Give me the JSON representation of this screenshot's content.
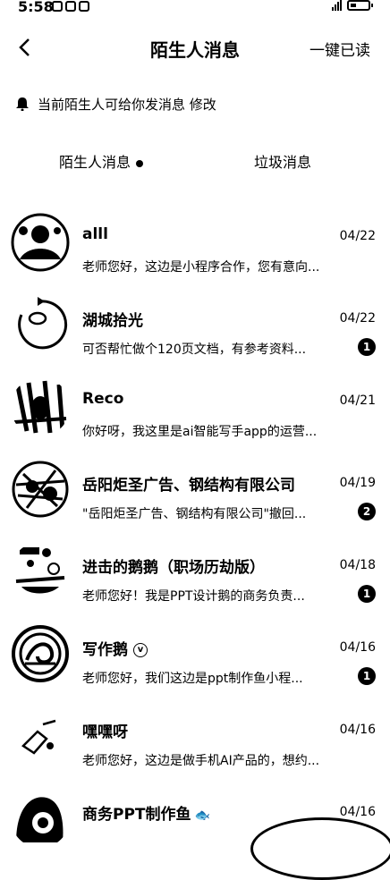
{
  "status": {
    "time": "5:58"
  },
  "header": {
    "title": "陌生人消息",
    "action": "一键已读"
  },
  "notice": {
    "text": "当前陌生人可给你发消息 修改"
  },
  "tabs": [
    {
      "label": "陌生人消息"
    },
    {
      "label": "垃圾消息"
    }
  ],
  "items": [
    {
      "name": "alll",
      "date": "04/22",
      "msg": "老师您好，这边是小程序合作，您有意向...",
      "badge": ""
    },
    {
      "name": "湖城拾光",
      "date": "04/22",
      "msg": "可否帮忙做个120页文档，有参考资料...",
      "badge": "1"
    },
    {
      "name": "Reco",
      "date": "04/21",
      "msg": "你好呀，我这里是ai智能写手app的运营...",
      "badge": ""
    },
    {
      "name": "岳阳炬圣广告、钢结构有限公司",
      "date": "04/19",
      "msg": "\"岳阳炬圣广告、钢结构有限公司\"撤回...",
      "badge": "2"
    },
    {
      "name": "进击的鹅鹅（职场历劫版）",
      "date": "04/18",
      "msg": "老师您好！我是PPT设计鹅的商务负责...",
      "badge": "1"
    },
    {
      "name": "写作鹅",
      "date": "04/16",
      "msg": "老师您好，我们这边是ppt制作鱼小程...",
      "badge": "1"
    },
    {
      "name": "嘿嘿呀",
      "date": "04/16",
      "msg": "老师您好，这边是做手机AI产品的，想约...",
      "badge": ""
    },
    {
      "name": "商务PPT制作鱼",
      "date": "04/16",
      "msg": "",
      "badge": ""
    }
  ]
}
